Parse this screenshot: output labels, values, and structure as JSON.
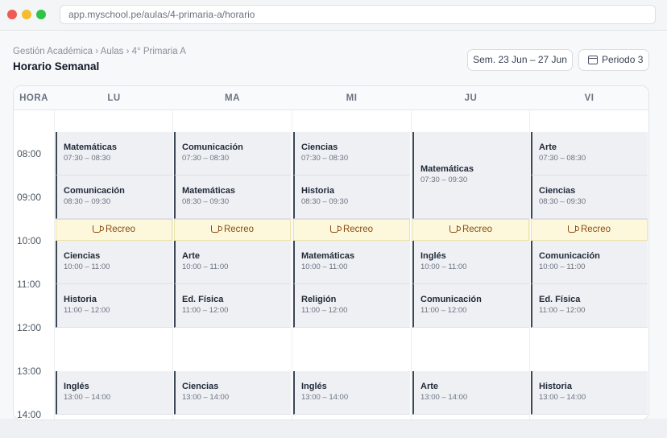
{
  "browser": {
    "url": "app.myschool.pe/aulas/4-primaria-a/horario"
  },
  "breadcrumb": "Gestión Académica › Aulas › 4° Primaria A",
  "page_title": "Horario Semanal",
  "toolbar": {
    "week_label": "Sem. 23 Jun – 27 Jun",
    "period_label": "Periodo 3"
  },
  "grid": {
    "hour_header": "HORA",
    "days": [
      "LU",
      "MA",
      "MI",
      "JU",
      "VI"
    ],
    "times": [
      "08:00",
      "09:00",
      "10:00",
      "11:00",
      "12:00",
      "13:00",
      "14:00"
    ],
    "break_label": "Recreo",
    "columns": [
      {
        "blocks": [
          {
            "subject": "Matemáticas",
            "time": "07:30 – 08:30"
          },
          {
            "subject": "Comunicación",
            "time": "08:30 – 09:30"
          },
          {
            "subject": "Ciencias",
            "time": "10:00 – 11:00"
          },
          {
            "subject": "Historia",
            "time": "11:00 – 12:00"
          },
          {
            "subject": "Inglés",
            "time": "13:00 – 14:00"
          }
        ]
      },
      {
        "blocks": [
          {
            "subject": "Comunicación",
            "time": "07:30 – 08:30"
          },
          {
            "subject": "Matemáticas",
            "time": "08:30 – 09:30"
          },
          {
            "subject": "Arte",
            "time": "10:00 – 11:00"
          },
          {
            "subject": "Ed. Física",
            "time": "11:00 – 12:00"
          },
          {
            "subject": "Ciencias",
            "time": "13:00 – 14:00"
          }
        ]
      },
      {
        "blocks": [
          {
            "subject": "Ciencias",
            "time": "07:30 – 08:30"
          },
          {
            "subject": "Historia",
            "time": "08:30 – 09:30"
          },
          {
            "subject": "Matemáticas",
            "time": "10:00 – 11:00"
          },
          {
            "subject": "Religión",
            "time": "11:00 – 12:00"
          },
          {
            "subject": "Inglés",
            "time": "13:00 – 14:00"
          }
        ]
      },
      {
        "blocks": [
          {
            "subject": "Matemáticas",
            "time": "07:30 – 09:30"
          },
          {
            "subject": "Inglés",
            "time": "10:00 – 11:00"
          },
          {
            "subject": "Comunicación",
            "time": "11:00 – 12:00"
          },
          {
            "subject": "Arte",
            "time": "13:00 – 14:00"
          }
        ]
      },
      {
        "blocks": [
          {
            "subject": "Arte",
            "time": "07:30 – 08:30"
          },
          {
            "subject": "Ciencias",
            "time": "08:30 – 09:30"
          },
          {
            "subject": "Comunicación",
            "time": "10:00 – 11:00"
          },
          {
            "subject": "Ed. Física",
            "time": "11:00 – 12:00"
          },
          {
            "subject": "Historia",
            "time": "13:00 – 14:00"
          }
        ]
      }
    ]
  }
}
